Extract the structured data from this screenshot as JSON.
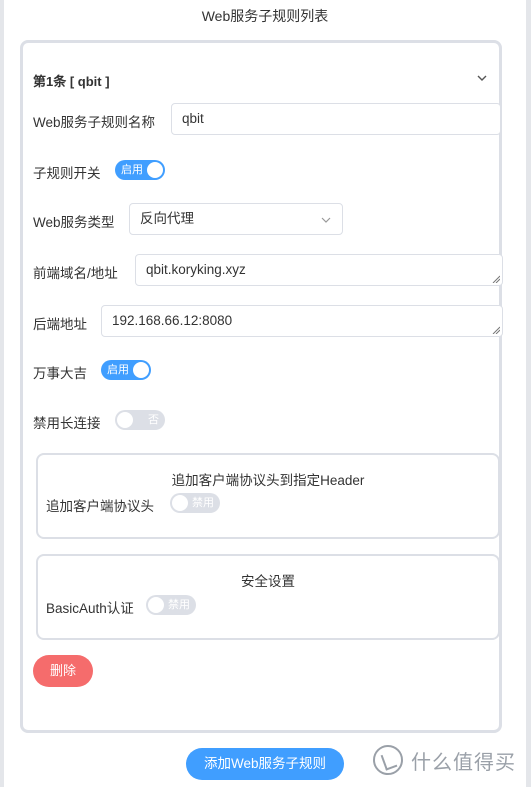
{
  "window": {
    "title": "Web服务子规则列表"
  },
  "rule": {
    "header": "第1条 [ qbit ]",
    "fields": {
      "name": {
        "label": "Web服务子规则名称",
        "value": "qbit"
      },
      "enable": {
        "label": "子规则开关",
        "switch_text": "启用",
        "state": "on"
      },
      "type": {
        "label": "Web服务类型",
        "value": "反向代理"
      },
      "frontend": {
        "label": "前端域名/地址",
        "value": "qbit.koryking.xyz"
      },
      "backend": {
        "label": "后端地址",
        "value": "192.168.66.12:8080"
      },
      "wanshi": {
        "label": "万事大吉",
        "switch_text": "启用",
        "state": "on"
      },
      "keepalive": {
        "label": "禁用长连接",
        "switch_text": "否",
        "state": "off"
      }
    },
    "header_box": {
      "title": "追加客户端协议头到指定Header",
      "field_label": "追加客户端协议头",
      "switch_text": "禁用",
      "state": "off"
    },
    "security_box": {
      "title": "安全设置",
      "field_label": "BasicAuth认证",
      "switch_text": "禁用",
      "state": "off"
    },
    "delete_label": "删除"
  },
  "add_button_label": "添加Web服务子规则",
  "watermark": "什么值得买",
  "colors": {
    "primary": "#409eff",
    "danger": "#f56c6c",
    "border": "#dcdfe6"
  },
  "icons": {
    "collapse": "chevron-down-icon",
    "select": "chevron-down-icon"
  }
}
